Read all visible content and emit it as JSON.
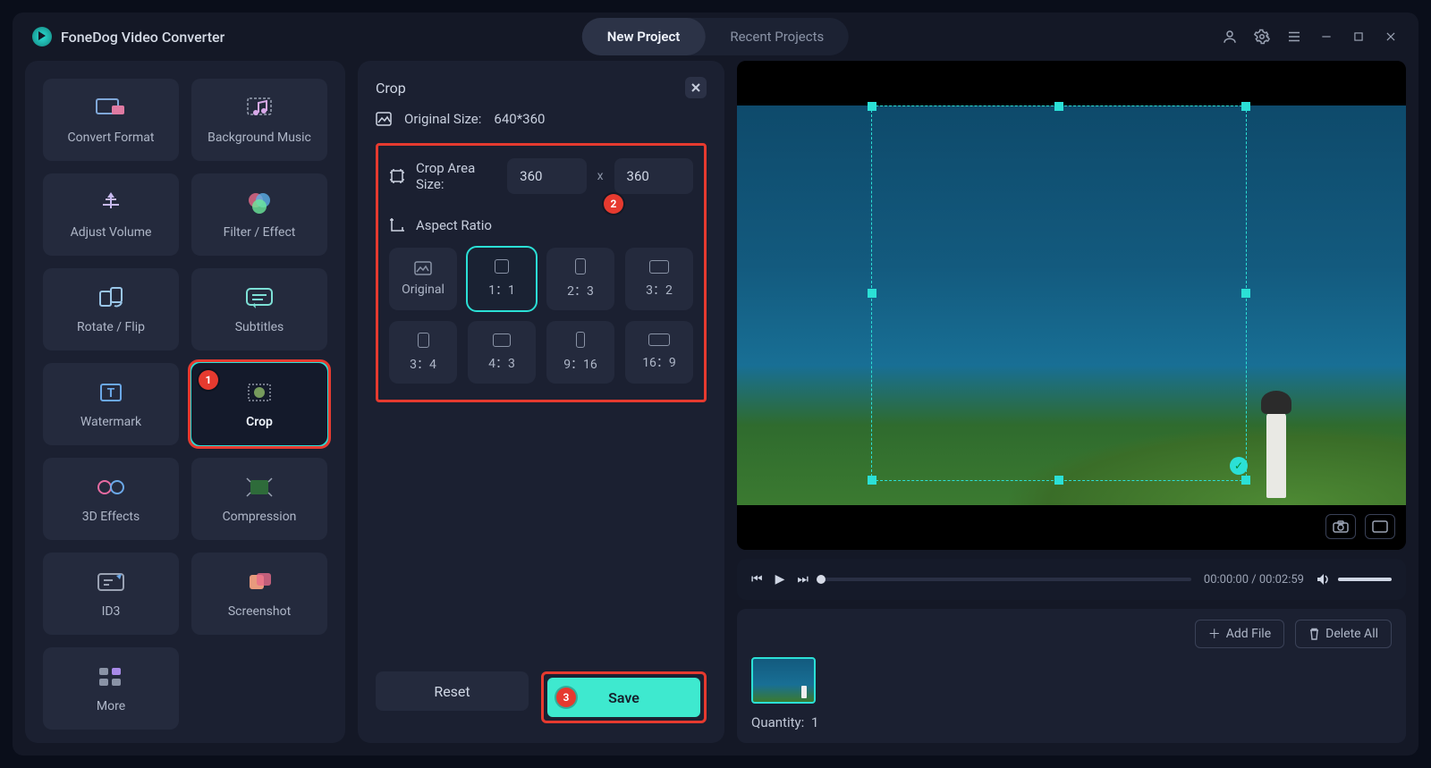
{
  "app": {
    "title": "FoneDog Video Converter"
  },
  "tabs": {
    "new_project": "New Project",
    "recent_projects": "Recent Projects"
  },
  "sidebar": {
    "tools": [
      {
        "id": "convert-format",
        "label": "Convert Format"
      },
      {
        "id": "background-music",
        "label": "Background Music"
      },
      {
        "id": "adjust-volume",
        "label": "Adjust Volume"
      },
      {
        "id": "filter-effect",
        "label": "Filter / Effect"
      },
      {
        "id": "rotate-flip",
        "label": "Rotate / Flip"
      },
      {
        "id": "subtitles",
        "label": "Subtitles"
      },
      {
        "id": "watermark",
        "label": "Watermark"
      },
      {
        "id": "crop",
        "label": "Crop"
      },
      {
        "id": "3d-effects",
        "label": "3D Effects"
      },
      {
        "id": "compression",
        "label": "Compression"
      },
      {
        "id": "id3",
        "label": "ID3"
      },
      {
        "id": "screenshot",
        "label": "Screenshot"
      },
      {
        "id": "more",
        "label": "More"
      }
    ],
    "selected": "crop"
  },
  "callouts": {
    "c1": "1",
    "c2": "2",
    "c3": "3"
  },
  "crop_panel": {
    "title": "Crop",
    "original_size_label": "Original Size:",
    "original_size_value": "640*360",
    "crop_area_label": "Crop Area Size:",
    "crop_w": "360",
    "crop_h": "360",
    "x_sep": "x",
    "aspect_label": "Aspect Ratio",
    "ratios": [
      {
        "id": "original",
        "label": "Original"
      },
      {
        "id": "1-1",
        "label": "1：1"
      },
      {
        "id": "2-3",
        "label": "2：3"
      },
      {
        "id": "3-2",
        "label": "3：2"
      },
      {
        "id": "3-4",
        "label": "3：4"
      },
      {
        "id": "4-3",
        "label": "4：3"
      },
      {
        "id": "9-16",
        "label": "9：16"
      },
      {
        "id": "16-9",
        "label": "16：9"
      }
    ],
    "selected_ratio": "1-1",
    "reset": "Reset",
    "save": "Save"
  },
  "player": {
    "current": "00:00:00",
    "total": "00:02:59",
    "sep": " / "
  },
  "strip": {
    "add_file": "Add File",
    "delete_all": "Delete All",
    "quantity_label": "Quantity:",
    "quantity_value": "1"
  },
  "colors": {
    "accent": "#2be0d6",
    "danger": "#e63a2f"
  }
}
